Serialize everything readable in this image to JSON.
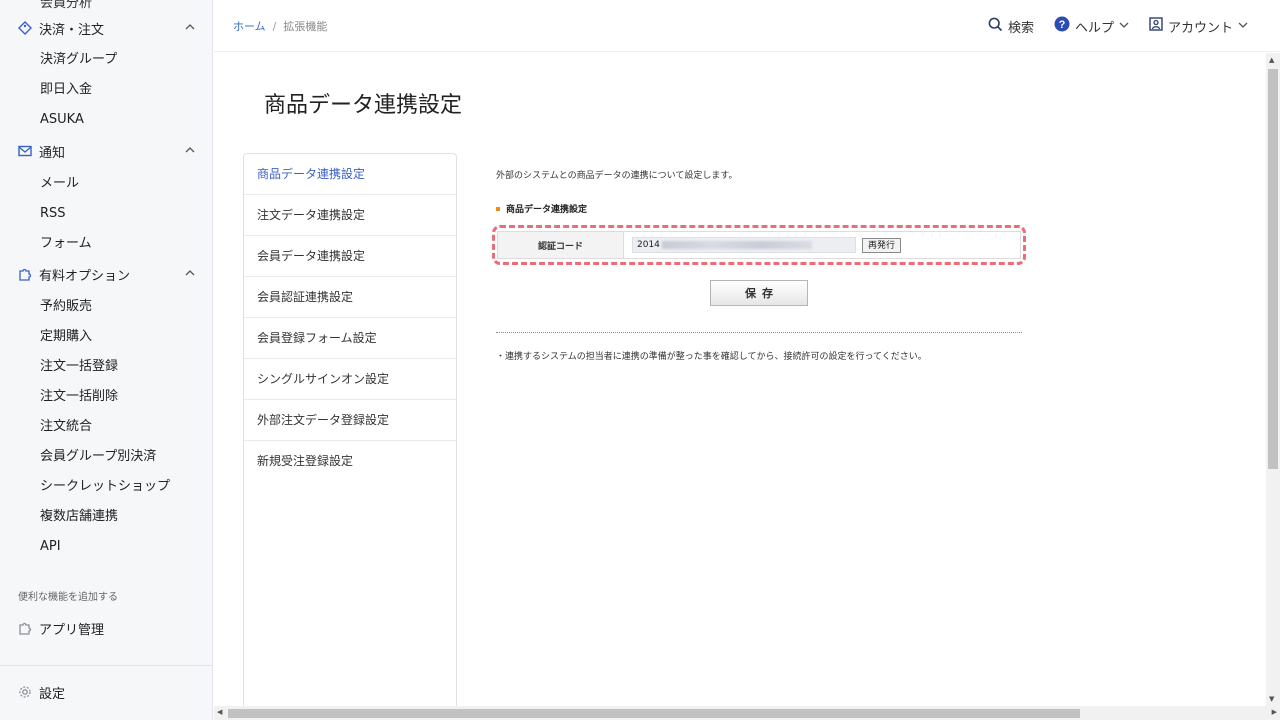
{
  "sidebar": {
    "cut_item": "会員分析",
    "groups": {
      "payment": {
        "label": "決済・注文",
        "items": [
          "決済グループ",
          "即日入金",
          "ASUKA"
        ]
      },
      "notice": {
        "label": "通知",
        "items": [
          "メール",
          "RSS",
          "フォーム"
        ]
      },
      "options": {
        "label": "有料オプション",
        "items": [
          "予約販売",
          "定期購入",
          "注文一括登録",
          "注文一括削除",
          "注文統合",
          "会員グループ別決済",
          "シークレットショップ",
          "複数店舗連携",
          "API"
        ]
      }
    },
    "caption": "便利な機能を追加する",
    "apps": "アプリ管理",
    "settings": "設定"
  },
  "header": {
    "breadcrumb": {
      "home": "ホーム",
      "separator": "/",
      "current": "拡張機能"
    },
    "search": "検索",
    "help": "ヘルプ",
    "account": "アカウント"
  },
  "main": {
    "title": "商品データ連携設定",
    "subnav": [
      "商品データ連携設定",
      "注文データ連携設定",
      "会員データ連携設定",
      "会員認証連携設定",
      "会員登録フォーム設定",
      "シングルサインオン設定",
      "外部注文データ登録設定",
      "新規受注登録設定"
    ],
    "intro": "外部のシステムとの商品データの連携について設定します。",
    "section_label": "商品データ連携設定",
    "code_label": "認証コード",
    "code_value_prefix": "2014",
    "reissue_label": "再発行",
    "save_label": "保存",
    "note": "・連携するシステムの担当者に連携の準備が整った事を確認してから、接続許可の設定を行ってください。"
  },
  "colors": {
    "accent": "#3a5fc8",
    "highlight": "#ea6d78",
    "section_marker": "#f08a1c"
  }
}
